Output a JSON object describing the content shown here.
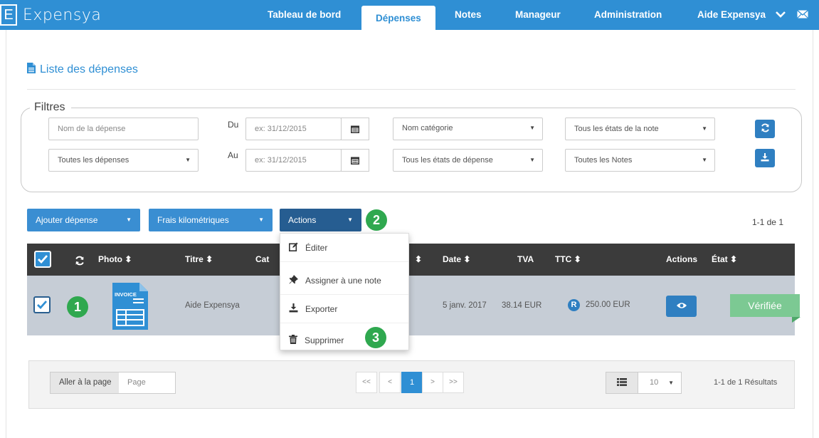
{
  "app": {
    "logo_letter": "E",
    "name": "Expensya"
  },
  "nav": {
    "items": [
      {
        "label": "Tableau de bord"
      },
      {
        "label": "Dépenses"
      },
      {
        "label": "Notes"
      },
      {
        "label": "Manageur"
      },
      {
        "label": "Administration"
      }
    ],
    "user_label": "Aide Expensya",
    "icons": [
      "chevron-down-icon",
      "envelope-icon"
    ]
  },
  "page": {
    "title": "Liste des dépenses",
    "title_icon": "document-icon"
  },
  "filters": {
    "legend": "Filtres",
    "name_placeholder": "Nom de la dépense",
    "expense_type": "Toutes les dépenses",
    "from_label": "Du",
    "to_label": "Au",
    "from_placeholder": "ex: 31/12/2015",
    "to_placeholder": "ex: 31/12/2015",
    "category": "Nom catégorie",
    "expense_state": "Tous les états de dépense",
    "note_state": "Tous les états de la note",
    "notes": "Toutes les Notes",
    "refresh_icon": "refresh-icon",
    "download_icon": "download-icon"
  },
  "toolbar": {
    "add_label": "Ajouter dépense",
    "mileage_label": "Frais kilométriques",
    "actions_label": "Actions",
    "count": "1-1 de 1"
  },
  "table": {
    "headers": {
      "photo": "Photo",
      "title": "Titre",
      "category": "Cat",
      "date": "Date",
      "vat": "TVA",
      "ttc": "TTC",
      "actions": "Actions",
      "state": "État"
    },
    "rows": [
      {
        "thumbnail_label": "INVOICE",
        "title": "Aide Expensya",
        "date": "5 janv. 2017",
        "vat": "38.14 EUR",
        "ttc_badge": "R",
        "ttc": "250.00 EUR",
        "status": "Vérifiée"
      }
    ]
  },
  "actions_menu": {
    "items": [
      {
        "label": "Éditer",
        "icon": "edit-icon"
      },
      {
        "label": "Assigner à une note",
        "icon": "pin-icon"
      },
      {
        "label": "Exporter",
        "icon": "download-icon"
      },
      {
        "label": "Supprimer",
        "icon": "trash-icon"
      }
    ]
  },
  "callouts": [
    "1",
    "2",
    "3"
  ],
  "pagination": {
    "goto_label": "Aller à la page",
    "goto_placeholder": "Page",
    "first": "<<",
    "prev": "<",
    "current": "1",
    "next": ">",
    "last": ">>",
    "per_page": "10",
    "results": "1-1 de 1 Résultats"
  },
  "colors": {
    "brand": "#2f8fd4",
    "header_dark": "#3b3b3b",
    "row_selected": "#c6cdd6",
    "status_verified": "#7cc993",
    "callout": "#2fa84f"
  }
}
